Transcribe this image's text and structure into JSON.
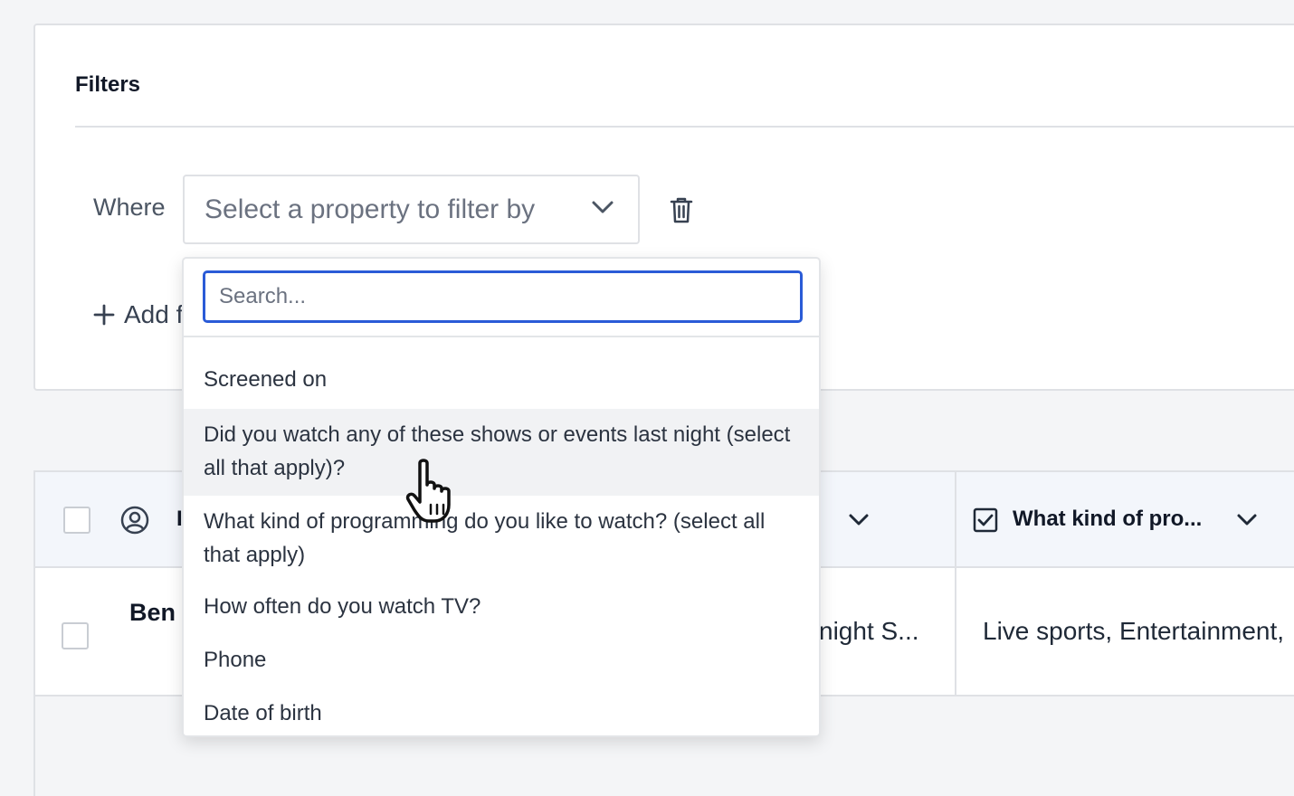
{
  "filters": {
    "title": "Filters",
    "where_label": "Where",
    "select_placeholder": "Select a property to filter by",
    "add_filter_label": "Add f"
  },
  "dropdown": {
    "search_placeholder": "Search...",
    "options": [
      {
        "label": "Screened on"
      },
      {
        "label": "Did you watch any of these shows or events last night (select all that apply)?"
      },
      {
        "label": "What kind of programming do you like to watch? (select all that apply)"
      },
      {
        "label": "How often do you watch TV?"
      },
      {
        "label": "Phone"
      },
      {
        "label": "Date of birth"
      }
    ],
    "hovered_index": 1
  },
  "table": {
    "header_partial": "I",
    "columns": [
      {
        "title": "What kind of pro..."
      }
    ],
    "rows": [
      {
        "name": "Ben",
        "cells": [
          "night S...",
          "Live sports, Entertainment,"
        ]
      }
    ]
  },
  "colors": {
    "accent": "#2a5bd7",
    "border": "#dfe1e5",
    "header_bg": "#f3f6fb",
    "hover_bg": "#f1f2f4"
  },
  "icons": [
    "chevron-down-icon",
    "trash-icon",
    "plus-icon",
    "user-circle-icon",
    "checkbox-icon",
    "hand-pointer-icon"
  ]
}
